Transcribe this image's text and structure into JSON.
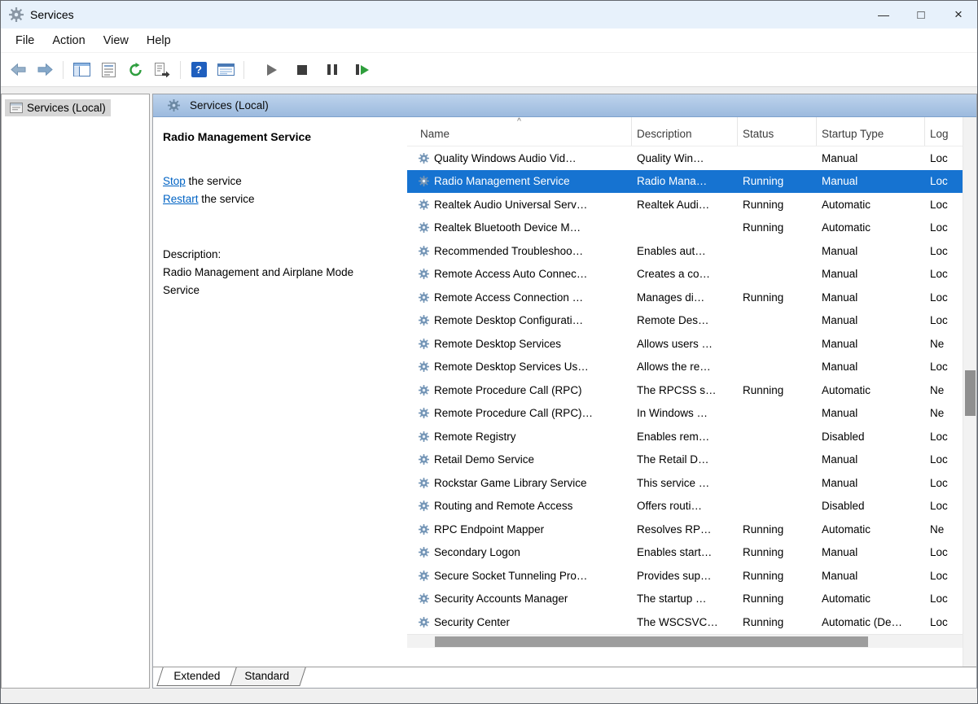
{
  "window": {
    "title": "Services",
    "controls": {
      "minimize": "—",
      "maximize": "□",
      "close": "×"
    }
  },
  "menu": {
    "items": [
      "File",
      "Action",
      "View",
      "Help"
    ]
  },
  "toolbar": {
    "help_glyph": "?",
    "buttons": [
      "back-arrow",
      "forward-arrow",
      "show-console-tree",
      "properties",
      "refresh",
      "export-list",
      "help",
      "properties-window",
      "start-service",
      "stop-service",
      "pause-service",
      "restart-service"
    ]
  },
  "tree": {
    "items": [
      {
        "label": "Services (Local)",
        "selected": true
      }
    ]
  },
  "panel": {
    "header": "Services (Local)"
  },
  "detail": {
    "service_title": "Radio Management Service",
    "stop_link": "Stop",
    "stop_suffix": " the service",
    "restart_link": "Restart",
    "restart_suffix": " the service",
    "description_label": "Description:",
    "description_text": "Radio Management and Airplane Mode Service"
  },
  "list": {
    "columns": [
      "Name",
      "Description",
      "Status",
      "Startup Type",
      "Log"
    ],
    "sort_indicator": "^",
    "selected_index": 1,
    "rows": [
      {
        "name": "Quality Windows Audio Vid…",
        "description": "Quality Win…",
        "status": "",
        "startup_type": "Manual",
        "log_on_as": "Loc"
      },
      {
        "name": "Radio Management Service",
        "description": "Radio Mana…",
        "status": "Running",
        "startup_type": "Manual",
        "log_on_as": "Loc"
      },
      {
        "name": "Realtek Audio Universal Serv…",
        "description": "Realtek Audi…",
        "status": "Running",
        "startup_type": "Automatic",
        "log_on_as": "Loc"
      },
      {
        "name": "Realtek Bluetooth Device M…",
        "description": "",
        "status": "Running",
        "startup_type": "Automatic",
        "log_on_as": "Loc"
      },
      {
        "name": "Recommended Troubleshoo…",
        "description": "Enables aut…",
        "status": "",
        "startup_type": "Manual",
        "log_on_as": "Loc"
      },
      {
        "name": "Remote Access Auto Connec…",
        "description": "Creates a co…",
        "status": "",
        "startup_type": "Manual",
        "log_on_as": "Loc"
      },
      {
        "name": "Remote Access Connection …",
        "description": "Manages di…",
        "status": "Running",
        "startup_type": "Manual",
        "log_on_as": "Loc"
      },
      {
        "name": "Remote Desktop Configurati…",
        "description": "Remote Des…",
        "status": "",
        "startup_type": "Manual",
        "log_on_as": "Loc"
      },
      {
        "name": "Remote Desktop Services",
        "description": "Allows users …",
        "status": "",
        "startup_type": "Manual",
        "log_on_as": "Ne"
      },
      {
        "name": "Remote Desktop Services Us…",
        "description": "Allows the re…",
        "status": "",
        "startup_type": "Manual",
        "log_on_as": "Loc"
      },
      {
        "name": "Remote Procedure Call (RPC)",
        "description": "The RPCSS s…",
        "status": "Running",
        "startup_type": "Automatic",
        "log_on_as": "Ne"
      },
      {
        "name": "Remote Procedure Call (RPC)…",
        "description": "In Windows …",
        "status": "",
        "startup_type": "Manual",
        "log_on_as": "Ne"
      },
      {
        "name": "Remote Registry",
        "description": "Enables rem…",
        "status": "",
        "startup_type": "Disabled",
        "log_on_as": "Loc"
      },
      {
        "name": "Retail Demo Service",
        "description": "The Retail D…",
        "status": "",
        "startup_type": "Manual",
        "log_on_as": "Loc"
      },
      {
        "name": "Rockstar Game Library Service",
        "description": "This service …",
        "status": "",
        "startup_type": "Manual",
        "log_on_as": "Loc"
      },
      {
        "name": "Routing and Remote Access",
        "description": "Offers routi…",
        "status": "",
        "startup_type": "Disabled",
        "log_on_as": "Loc"
      },
      {
        "name": "RPC Endpoint Mapper",
        "description": "Resolves RP…",
        "status": "Running",
        "startup_type": "Automatic",
        "log_on_as": "Ne"
      },
      {
        "name": "Secondary Logon",
        "description": "Enables start…",
        "status": "Running",
        "startup_type": "Manual",
        "log_on_as": "Loc"
      },
      {
        "name": "Secure Socket Tunneling Pro…",
        "description": "Provides sup…",
        "status": "Running",
        "startup_type": "Manual",
        "log_on_as": "Loc"
      },
      {
        "name": "Security Accounts Manager",
        "description": "The startup …",
        "status": "Running",
        "startup_type": "Automatic",
        "log_on_as": "Loc"
      },
      {
        "name": "Security Center",
        "description": "The WSCSVC…",
        "status": "Running",
        "startup_type": "Automatic (De…",
        "log_on_as": "Loc"
      }
    ]
  },
  "tabs": {
    "items": [
      {
        "label": "Extended",
        "active": true
      },
      {
        "label": "Standard",
        "active": false
      }
    ]
  }
}
